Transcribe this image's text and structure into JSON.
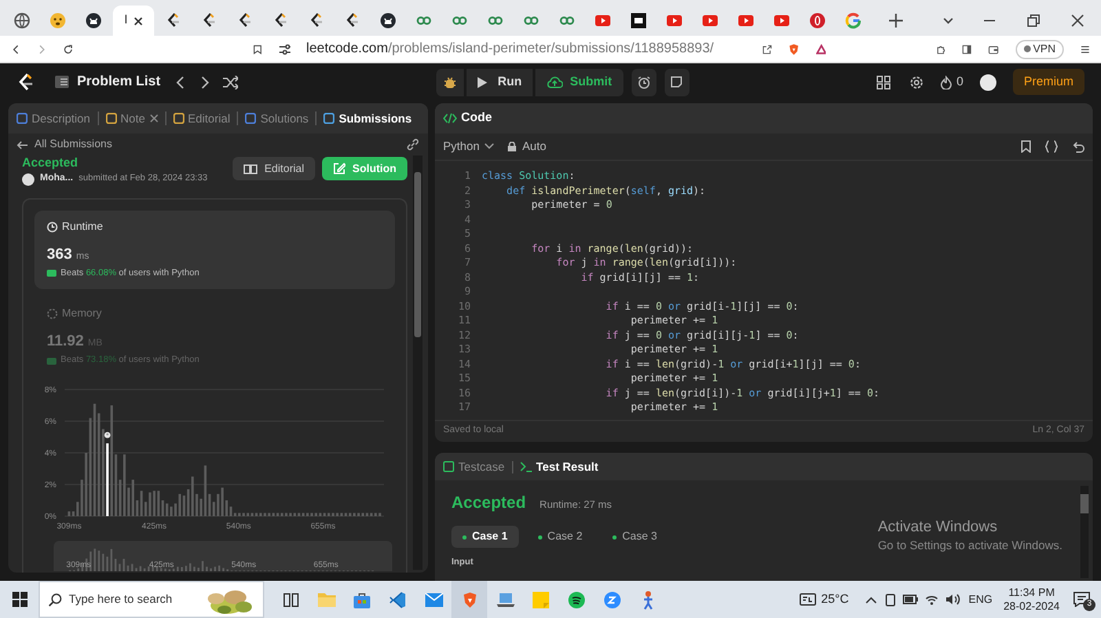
{
  "browser": {
    "tabs": [
      {
        "kind": "globe",
        "selected": false
      },
      {
        "kind": "emoji",
        "selected": false
      },
      {
        "kind": "github",
        "selected": false
      },
      {
        "kind": "page",
        "title": "I",
        "selected": true
      },
      {
        "kind": "leetcode",
        "selected": false
      },
      {
        "kind": "leetcode",
        "selected": false
      },
      {
        "kind": "leetcode",
        "selected": false
      },
      {
        "kind": "leetcode",
        "selected": false
      },
      {
        "kind": "leetcode",
        "selected": false
      },
      {
        "kind": "leetcode",
        "selected": false
      },
      {
        "kind": "github",
        "selected": false
      },
      {
        "kind": "link",
        "selected": false
      },
      {
        "kind": "link",
        "selected": false
      },
      {
        "kind": "link",
        "selected": false
      },
      {
        "kind": "link",
        "selected": false
      },
      {
        "kind": "link",
        "selected": false
      },
      {
        "kind": "youtube",
        "selected": false
      },
      {
        "kind": "dark",
        "selected": false
      },
      {
        "kind": "youtube",
        "selected": false
      },
      {
        "kind": "youtube",
        "selected": false
      },
      {
        "kind": "youtube",
        "selected": false
      },
      {
        "kind": "youtube",
        "selected": false
      },
      {
        "kind": "opera",
        "selected": false
      },
      {
        "kind": "google",
        "selected": false
      }
    ],
    "url_domain": "leetcode.com",
    "url_path": "/problems/island-perimeter/submissions/1188958893/",
    "vpn": "VPN"
  },
  "topbar": {
    "problem_list": "Problem List",
    "run": "Run",
    "submit": "Submit",
    "streak": "0",
    "premium": "Premium"
  },
  "left": {
    "tabs": [
      {
        "label": "Description",
        "selected": false,
        "closable": false
      },
      {
        "label": "Note",
        "selected": false,
        "closable": true
      },
      {
        "label": "Editorial",
        "selected": false,
        "closable": false
      },
      {
        "label": "Solutions",
        "selected": false,
        "closable": false
      },
      {
        "label": "Submissions",
        "selected": true,
        "closable": false
      }
    ],
    "back": "All Submissions",
    "status": "Accepted",
    "user": "Moha...",
    "submitted": "submitted at Feb 28, 2024 23:33",
    "editorial_button": "Editorial",
    "solution_button": "Solution",
    "runtime": {
      "title": "Runtime",
      "value": "363",
      "unit": "ms",
      "beats": "Beats",
      "percent": "66.08%",
      "suffix": "of users with Python"
    },
    "memory": {
      "title": "Memory",
      "value": "11.92",
      "unit": "MB",
      "beats": "Beats",
      "percent": "73.18%",
      "suffix": "of users with Python"
    },
    "chart_data": {
      "type": "bar",
      "xlim": [
        303,
        738
      ],
      "ylim": [
        0,
        8
      ],
      "yticks": [
        {
          "value": 0,
          "label": "0%"
        },
        {
          "value": 2,
          "label": "2%"
        },
        {
          "value": 4,
          "label": "4%"
        },
        {
          "value": 6,
          "label": "6%"
        },
        {
          "value": 8,
          "label": "8%"
        }
      ],
      "grid": true,
      "xticks": [
        {
          "value": 309,
          "label": "309ms"
        },
        {
          "value": 425,
          "label": "425ms"
        },
        {
          "value": 540,
          "label": "540ms"
        },
        {
          "value": 655,
          "label": "655ms"
        }
      ],
      "x": [
        309,
        314.8,
        320.6,
        326.4,
        332.2,
        338,
        343.8,
        349.6,
        355.4,
        361.2,
        367,
        372.8,
        378.6,
        384.4,
        390.2,
        396,
        401.8,
        407.6,
        413.4,
        419.2,
        425,
        430.8,
        436.6,
        442.4,
        448.2,
        454,
        459.8,
        465.6,
        471.4,
        477.2,
        483,
        488.8,
        494.6,
        500.4,
        506.2,
        512,
        517.8,
        523.6,
        529.4,
        535.2,
        541,
        546.8,
        552.6,
        558.4,
        564.2,
        570,
        575.8,
        581.6,
        587.4,
        593.2,
        599,
        604.8,
        610.6,
        616.4,
        622.2,
        628,
        633.8,
        639.6,
        645.4,
        651.2,
        657,
        662.8,
        668.6,
        674.4,
        680.2,
        686,
        691.8,
        697.6,
        703.4,
        709.2,
        715,
        720.8,
        726.6,
        732.4
      ],
      "series": [
        {
          "color": "#5c5c5c",
          "values": [
            0.3,
            0.3,
            0.9,
            2.3,
            4.0,
            6.2,
            7.1,
            6.5,
            5.5,
            null,
            7.0,
            3.9,
            2.3,
            3.9,
            1.8,
            2.3,
            1.0,
            1.6,
            0.9,
            1.5,
            1.6,
            1.6,
            1.0,
            0.8,
            0.6,
            0.8,
            1.4,
            1.3,
            1.7,
            2.5,
            1.4,
            1.1,
            3.2,
            1.4,
            0.9,
            1.4,
            1.8,
            1.0,
            0.6,
            0.2,
            0.2,
            0.2,
            0.2,
            0.2,
            0.2,
            0.2,
            0.2,
            0.2,
            0.2,
            0.2,
            0.2,
            0.2,
            0.2,
            0.2,
            0.2,
            0.2,
            0.2,
            0.2,
            0.2,
            0.2,
            0.2,
            0.2,
            0.2,
            0.2,
            0.2,
            0.2,
            0.2,
            0.2,
            0.2,
            0.2,
            0.2,
            0.2,
            0.2,
            0.2
          ]
        },
        {
          "color": "#ffffff",
          "values": [
            null,
            null,
            null,
            null,
            null,
            null,
            null,
            null,
            null,
            4.6,
            null,
            null,
            null,
            null,
            null,
            null,
            null,
            null,
            null,
            null,
            null,
            null,
            null,
            null,
            null,
            null,
            null,
            null,
            null,
            null,
            null,
            null,
            null,
            null,
            null,
            null,
            null,
            null,
            null,
            null,
            null,
            null,
            null,
            null,
            null,
            null,
            null,
            null,
            null,
            null,
            null,
            null,
            null,
            null,
            null,
            null,
            null,
            null,
            null,
            null,
            null,
            null,
            null,
            null,
            null,
            null,
            null,
            null,
            null,
            null,
            null,
            null,
            null,
            null
          ]
        }
      ]
    },
    "overview_labels": [
      "309ms",
      "425ms",
      "540ms",
      "655ms"
    ]
  },
  "code": {
    "title": "Code",
    "language": "Python",
    "mode": "Auto",
    "lines": [
      {
        "number": "1",
        "segments": [
          {
            "text": "class",
            "kind": "keyword"
          },
          {
            "text": " Solution",
            "kind": "type"
          },
          {
            "text": ":",
            "kind": "plain"
          }
        ]
      },
      {
        "number": "2",
        "segments": [
          {
            "text": "    def",
            "kind": "keyword"
          },
          {
            "text": " islandPerimeter",
            "kind": "function"
          },
          {
            "text": "(",
            "kind": "plain"
          },
          {
            "text": "self",
            "kind": "keyword"
          },
          {
            "text": ", ",
            "kind": "plain"
          },
          {
            "text": "grid",
            "kind": "variable"
          },
          {
            "text": "):",
            "kind": "plain"
          }
        ]
      },
      {
        "number": "3",
        "segments": [
          {
            "text": "        perimeter = ",
            "kind": "plain"
          },
          {
            "text": "0",
            "kind": "number"
          }
        ]
      },
      {
        "number": "4"
      },
      {
        "number": "5"
      },
      {
        "number": "6",
        "segments": [
          {
            "text": "        for",
            "kind": "control"
          },
          {
            "text": " i ",
            "kind": "plain"
          },
          {
            "text": "in",
            "kind": "control"
          },
          {
            "text": " range",
            "kind": "function"
          },
          {
            "text": "(",
            "kind": "plain"
          },
          {
            "text": "len",
            "kind": "function"
          },
          {
            "text": "(grid)):",
            "kind": "plain"
          }
        ]
      },
      {
        "number": "7",
        "segments": [
          {
            "text": "            for",
            "kind": "control"
          },
          {
            "text": " j ",
            "kind": "plain"
          },
          {
            "text": "in",
            "kind": "control"
          },
          {
            "text": " range",
            "kind": "function"
          },
          {
            "text": "(",
            "kind": "plain"
          },
          {
            "text": "len",
            "kind": "function"
          },
          {
            "text": "(grid[i])):",
            "kind": "plain"
          }
        ]
      },
      {
        "number": "8",
        "segments": [
          {
            "text": "                if",
            "kind": "control"
          },
          {
            "text": " grid[i][j] == ",
            "kind": "plain"
          },
          {
            "text": "1",
            "kind": "number"
          },
          {
            "text": ":",
            "kind": "plain"
          }
        ]
      },
      {
        "number": "9"
      },
      {
        "number": "10",
        "segments": [
          {
            "text": "                    if",
            "kind": "control"
          },
          {
            "text": " i == ",
            "kind": "plain"
          },
          {
            "text": "0",
            "kind": "number"
          },
          {
            "text": " or",
            "kind": "keyword"
          },
          {
            "text": " grid[i-",
            "kind": "plain"
          },
          {
            "text": "1",
            "kind": "number"
          },
          {
            "text": "][j] == ",
            "kind": "plain"
          },
          {
            "text": "0",
            "kind": "number"
          },
          {
            "text": ":",
            "kind": "plain"
          }
        ]
      },
      {
        "number": "11",
        "segments": [
          {
            "text": "                        perimeter += ",
            "kind": "plain"
          },
          {
            "text": "1",
            "kind": "number"
          }
        ]
      },
      {
        "number": "12",
        "segments": [
          {
            "text": "                    if",
            "kind": "control"
          },
          {
            "text": " j == ",
            "kind": "plain"
          },
          {
            "text": "0",
            "kind": "number"
          },
          {
            "text": " or",
            "kind": "keyword"
          },
          {
            "text": " grid[i][j-",
            "kind": "plain"
          },
          {
            "text": "1",
            "kind": "number"
          },
          {
            "text": "] == ",
            "kind": "plain"
          },
          {
            "text": "0",
            "kind": "number"
          },
          {
            "text": ":",
            "kind": "plain"
          }
        ]
      },
      {
        "number": "13",
        "segments": [
          {
            "text": "                        perimeter += ",
            "kind": "plain"
          },
          {
            "text": "1",
            "kind": "number"
          }
        ]
      },
      {
        "number": "14",
        "segments": [
          {
            "text": "                    if",
            "kind": "control"
          },
          {
            "text": " i == ",
            "kind": "plain"
          },
          {
            "text": "len",
            "kind": "function"
          },
          {
            "text": "(grid)-",
            "kind": "plain"
          },
          {
            "text": "1",
            "kind": "number"
          },
          {
            "text": " or",
            "kind": "keyword"
          },
          {
            "text": " grid[i+",
            "kind": "plain"
          },
          {
            "text": "1",
            "kind": "number"
          },
          {
            "text": "][j] == ",
            "kind": "plain"
          },
          {
            "text": "0",
            "kind": "number"
          },
          {
            "text": ":",
            "kind": "plain"
          }
        ]
      },
      {
        "number": "15",
        "segments": [
          {
            "text": "                        perimeter += ",
            "kind": "plain"
          },
          {
            "text": "1",
            "kind": "number"
          }
        ]
      },
      {
        "number": "16",
        "segments": [
          {
            "text": "                    if",
            "kind": "control"
          },
          {
            "text": " j == ",
            "kind": "plain"
          },
          {
            "text": "len",
            "kind": "function"
          },
          {
            "text": "(grid[i])-",
            "kind": "plain"
          },
          {
            "text": "1",
            "kind": "number"
          },
          {
            "text": " or",
            "kind": "keyword"
          },
          {
            "text": " grid[i][j+",
            "kind": "plain"
          },
          {
            "text": "1",
            "kind": "number"
          },
          {
            "text": "] == ",
            "kind": "plain"
          },
          {
            "text": "0",
            "kind": "number"
          },
          {
            "text": ":",
            "kind": "plain"
          }
        ]
      },
      {
        "number": "17",
        "segments": [
          {
            "text": "                        perimeter += ",
            "kind": "plain"
          },
          {
            "text": "1",
            "kind": "number"
          }
        ]
      }
    ],
    "status": "Saved to local",
    "cursor": "Ln 2, Col 37"
  },
  "result": {
    "tabs": [
      {
        "label": "Testcase",
        "selected": false
      },
      {
        "label": "Test Result",
        "selected": true
      }
    ],
    "verdict": "Accepted",
    "runtime": "Runtime: 27 ms",
    "cases": [
      {
        "label": "Case 1",
        "selected": true
      },
      {
        "label": "Case 2",
        "selected": false
      },
      {
        "label": "Case 3",
        "selected": false
      }
    ],
    "input_label": "Input"
  },
  "activation": {
    "title": "Activate Windows",
    "text": "Go to Settings to activate Windows."
  },
  "taskbar": {
    "search_placeholder": "Type here to search",
    "apps": [
      {
        "kind": "taskview",
        "selected": false
      },
      {
        "kind": "folder",
        "selected": false
      },
      {
        "kind": "store",
        "selected": false
      },
      {
        "kind": "editor",
        "selected": false
      },
      {
        "kind": "mail",
        "selected": false
      },
      {
        "kind": "lion",
        "selected": true
      },
      {
        "kind": "laptop",
        "selected": false
      },
      {
        "kind": "note",
        "selected": false
      },
      {
        "kind": "music",
        "selected": false
      },
      {
        "kind": "zoom",
        "selected": false
      },
      {
        "kind": "figure",
        "selected": false
      }
    ],
    "temperature": "25°C",
    "language": "ENG",
    "time": "11:34 PM",
    "date": "28-02-2024",
    "notifications": "3"
  }
}
